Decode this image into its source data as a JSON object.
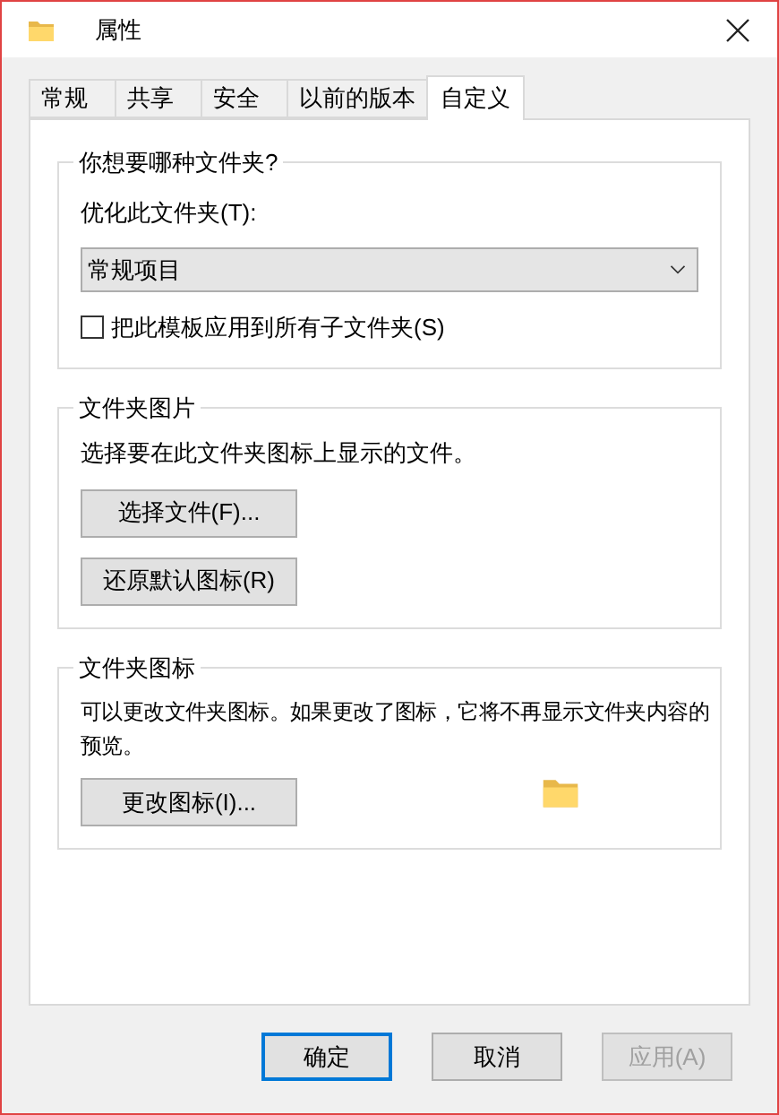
{
  "window": {
    "title": "属性"
  },
  "tabs": [
    {
      "label": "常规",
      "selected": false
    },
    {
      "label": "共享",
      "selected": false
    },
    {
      "label": "安全",
      "selected": false
    },
    {
      "label": "以前的版本",
      "selected": false
    },
    {
      "label": "自定义",
      "selected": true
    }
  ],
  "folder_type": {
    "title": "你想要哪种文件夹?",
    "optimize_label": "优化此文件夹(T):",
    "dropdown_value": "常规项目",
    "apply_checkbox": {
      "label": "把此模板应用到所有子文件夹(S)",
      "checked": false
    }
  },
  "folder_picture": {
    "title": "文件夹图片",
    "description": "选择要在此文件夹图标上显示的文件。",
    "buttons": [
      "选择文件(F)...",
      "还原默认图标(R)"
    ]
  },
  "folder_icon": {
    "title": "文件夹图标",
    "description": "可以更改文件夹图标。如果更改了图标，它将不再显示文件夹内容的预览。",
    "button": "更改图标(I)..."
  },
  "footer_buttons": [
    {
      "label": "确定",
      "kind": "default",
      "disabled": false
    },
    {
      "label": "取消",
      "kind": "normal",
      "disabled": false
    },
    {
      "label": "应用(A)",
      "kind": "normal",
      "disabled": true
    }
  ]
}
